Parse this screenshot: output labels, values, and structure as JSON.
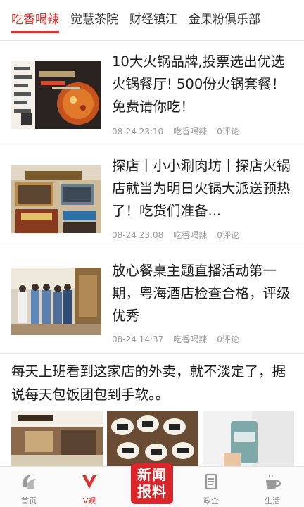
{
  "tabs": [
    {
      "label": "吃香喝辣",
      "active": true
    },
    {
      "label": "觉慧茶院",
      "active": false
    },
    {
      "label": "财经镇江",
      "active": false
    },
    {
      "label": "金果粉俱乐部",
      "active": false
    }
  ],
  "articles": [
    {
      "title": "10大火锅品牌,投票选出优选火锅餐厅! 500份火锅套餐！免费请你吃！",
      "time": "08-24 23:10",
      "source": "吃香喝辣",
      "comments": "0评论",
      "image": "hotpot-vote-poster"
    },
    {
      "title": "探店丨小小涮肉坊丨探店火锅店就当为明日火锅大派送预热了！吃货们准备...",
      "time": "08-24 23:08",
      "source": "吃香喝辣",
      "comments": "0评论",
      "image": "restaurant-storefront"
    },
    {
      "title": "放心餐桌主题直播活动第一期，粤海酒店检查合格，评级优秀",
      "time": "08-24 14:37",
      "source": "吃香喝辣",
      "comments": "0评论",
      "image": "inspection-officers"
    }
  ],
  "post": {
    "text": "每天上班看到这家店的外卖，就不淡定了，据说每天包饭团包到手软。。",
    "images": [
      "shop-interior",
      "rice-rolls-tray",
      "drink-cup"
    ]
  },
  "bottom_nav": [
    {
      "label": "首页",
      "icon": "home-swirl-icon"
    },
    {
      "label": "V观",
      "icon": "v-play-icon"
    },
    {
      "label": "新闻\n报料",
      "icon": "news-report-button"
    },
    {
      "label": "政企",
      "icon": "document-icon"
    },
    {
      "label": "生活",
      "icon": "coffee-cup-icon"
    }
  ],
  "colors": {
    "accent": "#e0302f",
    "text": "#1a1a1a",
    "meta": "#9a9a9a"
  }
}
